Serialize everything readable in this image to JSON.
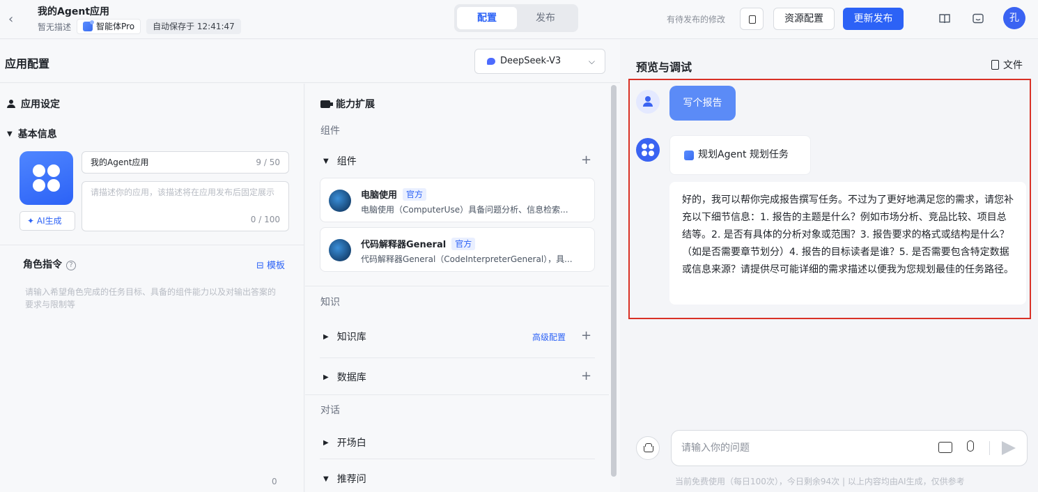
{
  "header": {
    "app_name": "我的Agent应用",
    "no_desc": "暂无描述",
    "agent_type": "智能体Pro",
    "autosave": "自动保存于 12:41:47",
    "tabs": [
      "配置",
      "发布"
    ],
    "pending": "有待发布的修改",
    "resource_btn": "资源配置",
    "publish_btn": "更新发布",
    "avatar": "孔"
  },
  "config": {
    "title": "应用配置",
    "model": "DeepSeek-V3",
    "app_settings": "应用设定",
    "basic_info": "基本信息",
    "name_value": "我的Agent应用",
    "name_count": "9 / 50",
    "desc_placeholder": "请描述你的应用，该描述将在应用发布后固定展示",
    "desc_count": "0 / 100",
    "ai_gen": "AI生成",
    "role_title": "角色指令",
    "template": "模板",
    "role_placeholder": "请输入希望角色完成的任务目标、具备的组件能力以及对输出答案的要求与限制等",
    "role_count": "0"
  },
  "capability": {
    "title": "能力扩展",
    "group_components": "组件",
    "components_label": "组件",
    "cards": [
      {
        "name": "电脑使用",
        "tag": "官方",
        "desc": "电脑使用（ComputerUse）具备问题分析、信息检索..."
      },
      {
        "name": "代码解释器General",
        "tag": "官方",
        "desc": "代码解释器General（CodeInterpreterGeneral），具..."
      }
    ],
    "group_knowledge": "知识",
    "kb_label": "知识库",
    "adv_config": "高级配置",
    "db_label": "数据库",
    "group_dialog": "对话",
    "opening": "开场白",
    "recommend": "推荐问"
  },
  "preview": {
    "title": "预览与调试",
    "file": "文件",
    "user_msg": "写个报告",
    "plan_label": "规划Agent 规划任务",
    "answer": "好的，我可以帮你完成报告撰写任务。不过为了更好地满足您的需求，请您补充以下细节信息：1. 报告的主题是什么？例如市场分析、竞品比较、项目总结等。2. 是否有具体的分析对象或范围？3. 报告要求的格式或结构是什么？（如是否需要章节划分）4. 报告的目标读者是谁？5. 是否需要包含特定数据或信息来源？请提供尽可能详细的需求描述以便我为您规划最佳的任务路径。",
    "input_placeholder": "请输入你的问题",
    "footer": "当前免费使用（每日100次），今日剩余94次 | 以上内容均由AI生成，仅供参考"
  },
  "colors": {
    "accent": "#2c62f6",
    "highlight": "#d93025"
  }
}
